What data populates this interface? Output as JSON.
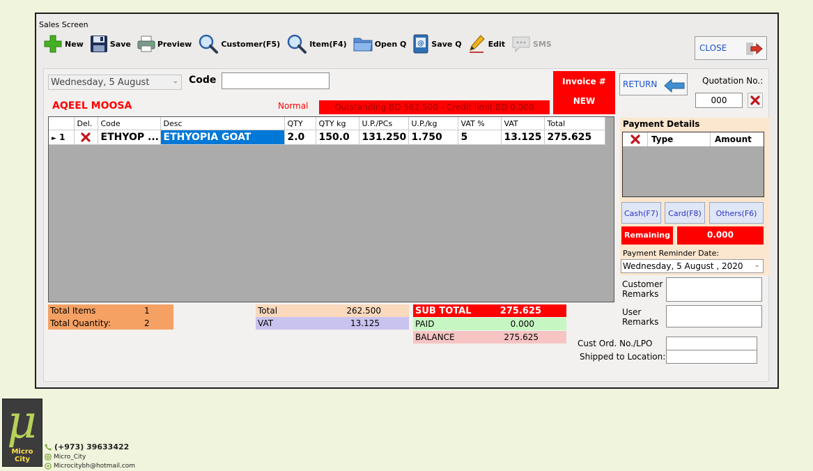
{
  "window": {
    "title": "Sales Screen"
  },
  "toolbar": {
    "new": "New",
    "save": "Save",
    "preview": "Preview",
    "customer": "Customer(F5)",
    "item": "Item(F4)",
    "open_q": "Open Q",
    "save_q": "Save Q",
    "edit": "Edit",
    "sms": "SMS"
  },
  "close_label": "CLOSE",
  "header": {
    "date": "Wednesday,   5    August",
    "code_label": "Code",
    "code_value": "",
    "invoice_label": "Invoice #",
    "invoice_value": "NEW",
    "return_label": "RETURN",
    "quotation_label": "Quotation No.:",
    "quotation_value": "000",
    "customer_name": "AQEEL MOOSA",
    "price_type": "Normal",
    "outstanding": "Outstanding BD 562.500 - Credit limit BD 0.000"
  },
  "grid": {
    "columns": [
      "Del.",
      "Code",
      "Desc",
      "QTY",
      "QTY kg",
      "U.P./PCs",
      "U.P./kg",
      "VAT %",
      "VAT",
      "Total"
    ],
    "rows": [
      {
        "num": "1",
        "code": "ETHYOP ...",
        "desc": "ETHYOPIA GOAT",
        "qty": "2.0",
        "qty_kg": "150.0",
        "up_pcs": "131.250",
        "up_kg": "1.750",
        "vat_pct": "5",
        "vat": "13.125",
        "total": "275.625"
      }
    ]
  },
  "payment": {
    "title": "Payment Details",
    "col_type": "Type",
    "col_amount": "Amount",
    "cash": "Cash(F7)",
    "card": "Card(F8)",
    "others": "Others(F6)",
    "remaining_label": "Remaining",
    "remaining_value": "0.000",
    "reminder_label": "Payment Reminder Date:",
    "reminder_date": "Wednesday,  5    August   , 2020"
  },
  "remarks": {
    "customer_label": "Customer\nRemarks",
    "user_label": "User\nRemarks",
    "cust_ord_label": "Cust Ord. No./LPO",
    "shipped_label": "Shipped to Location:"
  },
  "totals": {
    "total_items_label": "Total Items",
    "total_items_value": "1",
    "total_qty_label": "Total Quantity:",
    "total_qty_value": "2",
    "total_label": "Total",
    "total_value": "262.500",
    "vat_label": "VAT",
    "vat_value": "13.125",
    "subtotal_label": "SUB TOTAL",
    "subtotal_value": "275.625",
    "paid_label": "PAID",
    "paid_value": "0.000",
    "balance_label": "BALANCE",
    "balance_value": "275.625"
  },
  "branding": {
    "logo_glyph": "μ",
    "logo_text": "Micro City",
    "phone": "(+973) 39633422",
    "instagram": "Micro_City",
    "email": "Microcitybh@hotmail.com"
  },
  "colors": {
    "accent_red": "#ff0000",
    "link_blue": "#1a4fd0",
    "selected_blue": "#0078d7"
  }
}
